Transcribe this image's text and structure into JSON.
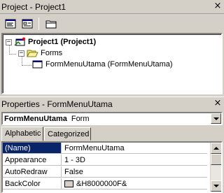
{
  "project_window": {
    "title": "Project - Project1",
    "close_glyph": "×",
    "toolbar": {
      "view_code_icon": "view-code-icon",
      "view_object_icon": "view-object-icon",
      "toggle_folders_icon": "folder-icon"
    },
    "tree": {
      "root": {
        "label": "Project1 (Project1)",
        "expanded": true,
        "toggle": "−"
      },
      "folder": {
        "label": "Forms",
        "expanded": true,
        "toggle": "−"
      },
      "item": {
        "label": "FormMenuUtama (FormMenuUtama)"
      }
    }
  },
  "properties_window": {
    "title": "Properties - FormMenuUtama",
    "close_glyph": "×",
    "object_selector": {
      "name": "FormMenuUtama",
      "type": "Form"
    },
    "tabs": [
      {
        "label": "Alphabetic",
        "active": true
      },
      {
        "label": "Categorized",
        "active": false
      }
    ],
    "rows": [
      {
        "name": "(Name)",
        "value": "FormMenuUtama",
        "selected": true
      },
      {
        "name": "Appearance",
        "value": "1 - 3D"
      },
      {
        "name": "AutoRedraw",
        "value": "False"
      },
      {
        "name": "BackColor",
        "value": "&H8000000F&",
        "swatch": "#d4d0c8"
      }
    ]
  }
}
